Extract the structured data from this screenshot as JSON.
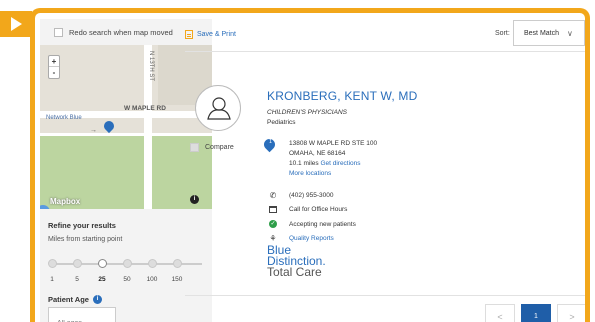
{
  "map_panel": {
    "redo_label": "Redo search when map moved",
    "zoom_in": "+",
    "zoom_out": "-",
    "street_v": "N 13TH ST",
    "street_h": "W MAPLE RD",
    "network_label": "Network Blue",
    "map_logo": "Mapbox",
    "info_glyph": "i"
  },
  "filters": {
    "refine_title": "Refine your results",
    "miles_label": "Miles from starting point",
    "miles_options": [
      "1",
      "5",
      "25",
      "50",
      "100",
      "150"
    ],
    "miles_selected": "25",
    "age_title": "Patient Age",
    "age_placeholder": "All ages"
  },
  "toolbar": {
    "save_print": "Save & Print",
    "sort_label": "Sort:",
    "sort_value": "Best Match",
    "sort_chevron": "∨"
  },
  "result": {
    "compare_label": "Compare",
    "name": "KRONBERG, KENT W, MD",
    "practice": "CHILDREN'S PHYSICIANS",
    "specialty": "Pediatrics",
    "pin_number": "1",
    "address_line1": "13808 W MAPLE RD STE 100",
    "address_line2": "OMAHA, NE 68164",
    "distance": "10.1 miles",
    "directions": "Get directions",
    "more_locations": "More locations",
    "phone": "(402) 955-3000",
    "hours": "Call for Office Hours",
    "accepting": "Accepting new patients",
    "quality": "Quality Reports",
    "bd_line1": "Blue",
    "bd_line2": "Distinction.",
    "bd_line3": "Total Care"
  },
  "pagination": {
    "prev": "<",
    "current": "1",
    "next": ">"
  },
  "colors": {
    "accent_orange": "#f2a71b",
    "link_blue": "#2a6ebb",
    "page_active": "#1f5ea8",
    "ok_green": "#2e9e49"
  }
}
